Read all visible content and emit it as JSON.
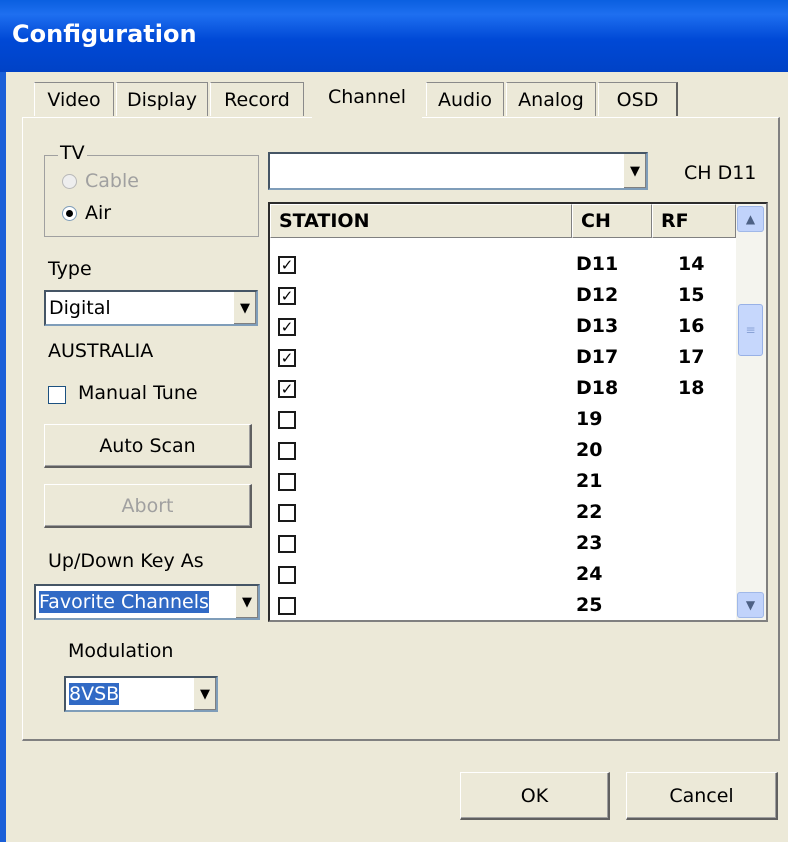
{
  "window": {
    "title": "Configuration"
  },
  "tabs": [
    {
      "label": "Video"
    },
    {
      "label": "Display"
    },
    {
      "label": "Record"
    },
    {
      "label": "Channel"
    },
    {
      "label": "Audio"
    },
    {
      "label": "Analog"
    },
    {
      "label": "OSD"
    }
  ],
  "tv_group": {
    "label": "TV",
    "cable_label": "Cable",
    "air_label": "Air",
    "selected": "Air"
  },
  "type": {
    "label": "Type",
    "value": "Digital",
    "country": "AUSTRALIA"
  },
  "manual_tune": {
    "label": "Manual Tune",
    "checked": false
  },
  "buttons": {
    "auto_scan": "Auto Scan",
    "abort": "Abort",
    "ok": "OK",
    "cancel": "Cancel"
  },
  "updown": {
    "label": "Up/Down Key As",
    "value": "Favorite Channels"
  },
  "modulation": {
    "label": "Modulation",
    "value": "8VSB"
  },
  "station_combo": {
    "value": ""
  },
  "channel_readout": "CH D11",
  "station_list": {
    "headers": {
      "station": "STATION",
      "ch": "CH",
      "rf": "RF"
    },
    "rows": [
      {
        "checked": true,
        "ch": "D11",
        "rf": "14"
      },
      {
        "checked": true,
        "ch": "D12",
        "rf": "15"
      },
      {
        "checked": true,
        "ch": "D13",
        "rf": "16"
      },
      {
        "checked": true,
        "ch": "D17",
        "rf": "17"
      },
      {
        "checked": true,
        "ch": "D18",
        "rf": "18"
      },
      {
        "checked": false,
        "ch": "19",
        "rf": ""
      },
      {
        "checked": false,
        "ch": "20",
        "rf": ""
      },
      {
        "checked": false,
        "ch": "21",
        "rf": ""
      },
      {
        "checked": false,
        "ch": "22",
        "rf": ""
      },
      {
        "checked": false,
        "ch": "23",
        "rf": ""
      },
      {
        "checked": false,
        "ch": "24",
        "rf": ""
      },
      {
        "checked": false,
        "ch": "25",
        "rf": ""
      }
    ]
  },
  "colors": {
    "titlebar": "#0049d6",
    "dialog_bg": "#ece9d8",
    "selection": "#316ac5"
  }
}
